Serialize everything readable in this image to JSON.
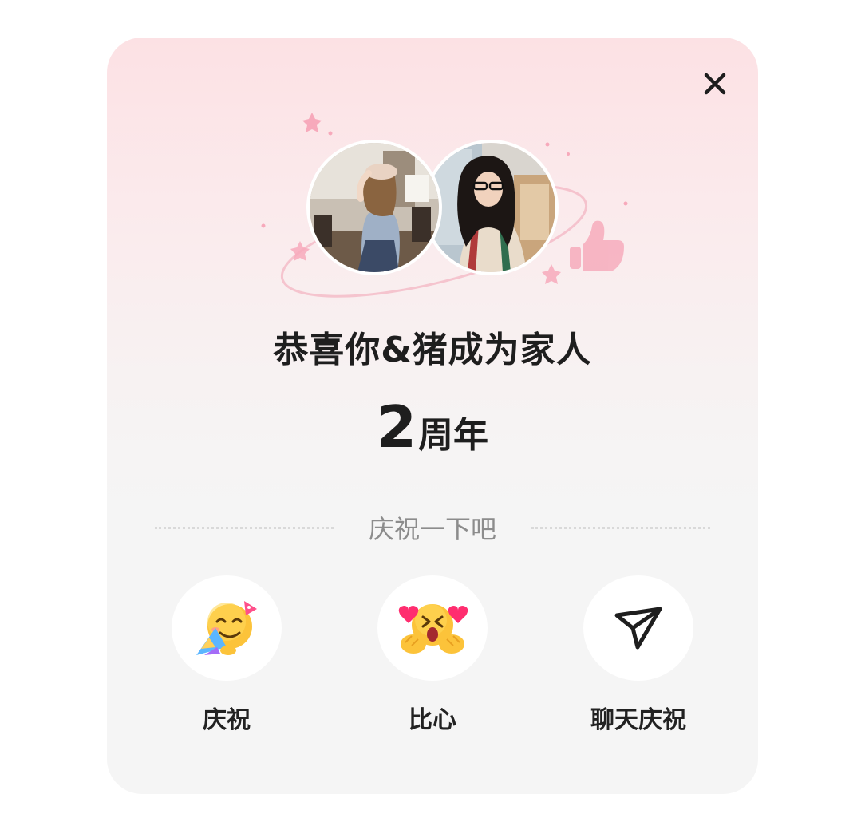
{
  "dialog": {
    "headline": "恭喜你&猪成为家人",
    "years_number": "2",
    "years_unit": "周年",
    "divider_label": "庆祝一下吧"
  },
  "actions": [
    {
      "label": "庆祝",
      "icon": "party-face-emoji-icon"
    },
    {
      "label": "比心",
      "icon": "heart-hands-emoji-icon"
    },
    {
      "label": "聊天庆祝",
      "icon": "send-icon"
    }
  ],
  "icons": {
    "close": "close-icon",
    "thumbs_up": "thumbs-up-icon"
  },
  "colors": {
    "text_primary": "#1e1e1e",
    "text_secondary": "#8c8c8c",
    "card_bg": "#f5f5f5",
    "accent_pink": "#f3a2b6"
  }
}
